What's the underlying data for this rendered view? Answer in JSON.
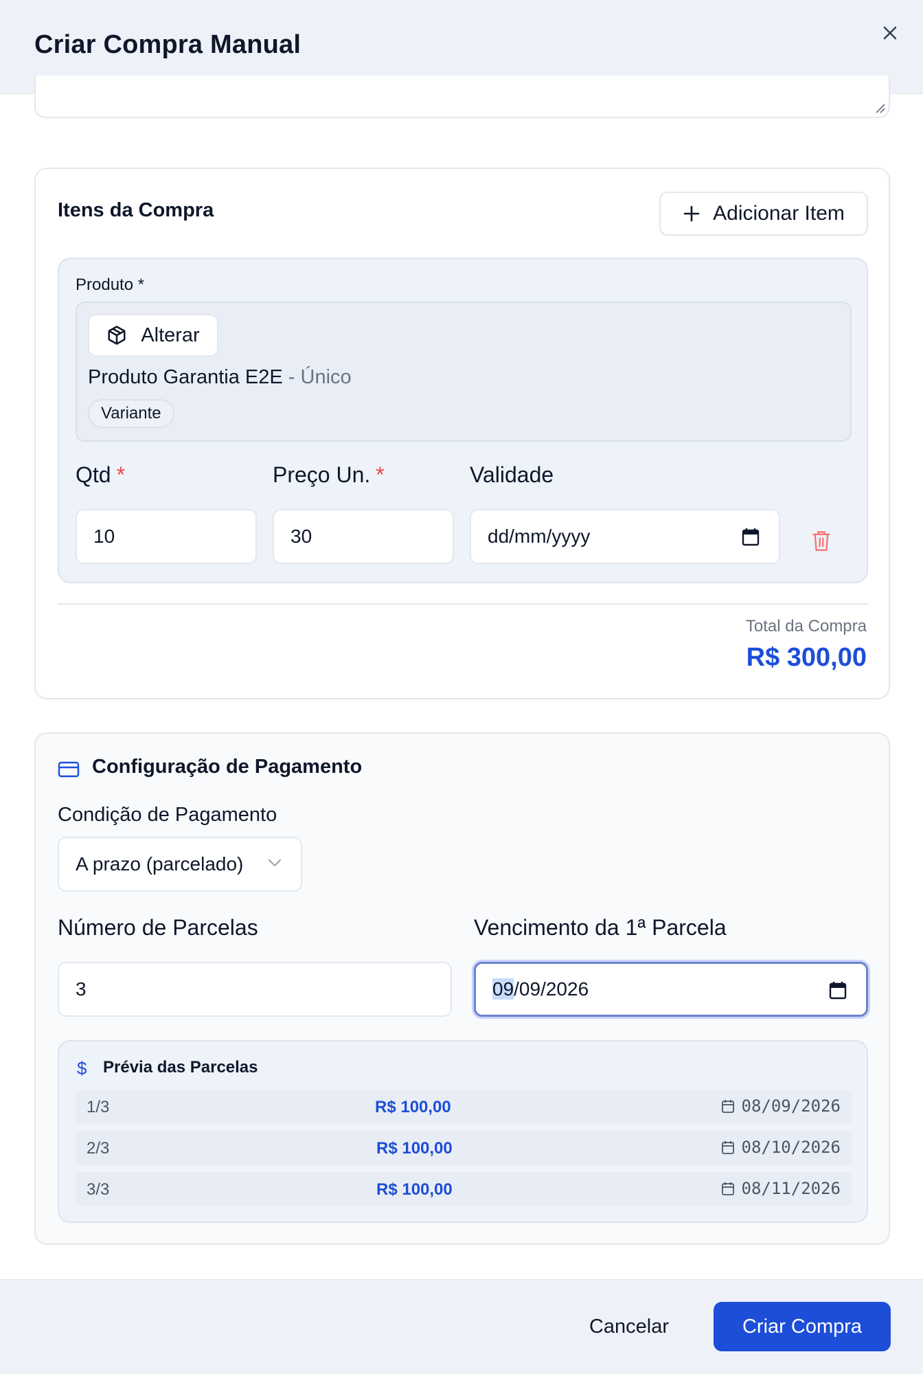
{
  "header": {
    "title": "Criar Compra Manual",
    "close_icon": "close-icon"
  },
  "items_section": {
    "title": "Itens da Compra",
    "add_item_label": "Adicionar Item",
    "item": {
      "product_label": "Produto *",
      "change_label": "Alterar",
      "product_name": "Produto Garantia E2E",
      "product_type": " - Único",
      "variant_badge": "Variante",
      "qty_label": "Qtd",
      "price_label": "Preço Un.",
      "validity_label": "Validade",
      "required_mark": "*",
      "qty_value": "10",
      "price_value": "30",
      "validity_placeholder": "dd/mm/yyyy"
    },
    "total_label": "Total da Compra",
    "total_value": "R$ 300,00"
  },
  "payment_section": {
    "title": "Configuração de Pagamento",
    "condition_label": "Condição de Pagamento",
    "condition_value": "A prazo (parcelado)",
    "installments_label": "Número de Parcelas",
    "installments_value": "3",
    "first_due_label": "Vencimento da 1ª Parcela",
    "first_due_day": "09",
    "first_due_rest": "/09/2026",
    "preview_title": "Prévia das Parcelas",
    "preview_icon": "$",
    "installments": [
      {
        "num": "1/3",
        "value": "R$ 100,00",
        "date": "08/09/2026"
      },
      {
        "num": "2/3",
        "value": "R$ 100,00",
        "date": "08/10/2026"
      },
      {
        "num": "3/3",
        "value": "R$ 100,00",
        "date": "08/11/2026"
      }
    ]
  },
  "footer": {
    "cancel_label": "Cancelar",
    "create_label": "Criar Compra"
  },
  "colors": {
    "primary": "#1d4ed8",
    "danger": "#ef4444",
    "muted": "#6b7280"
  }
}
